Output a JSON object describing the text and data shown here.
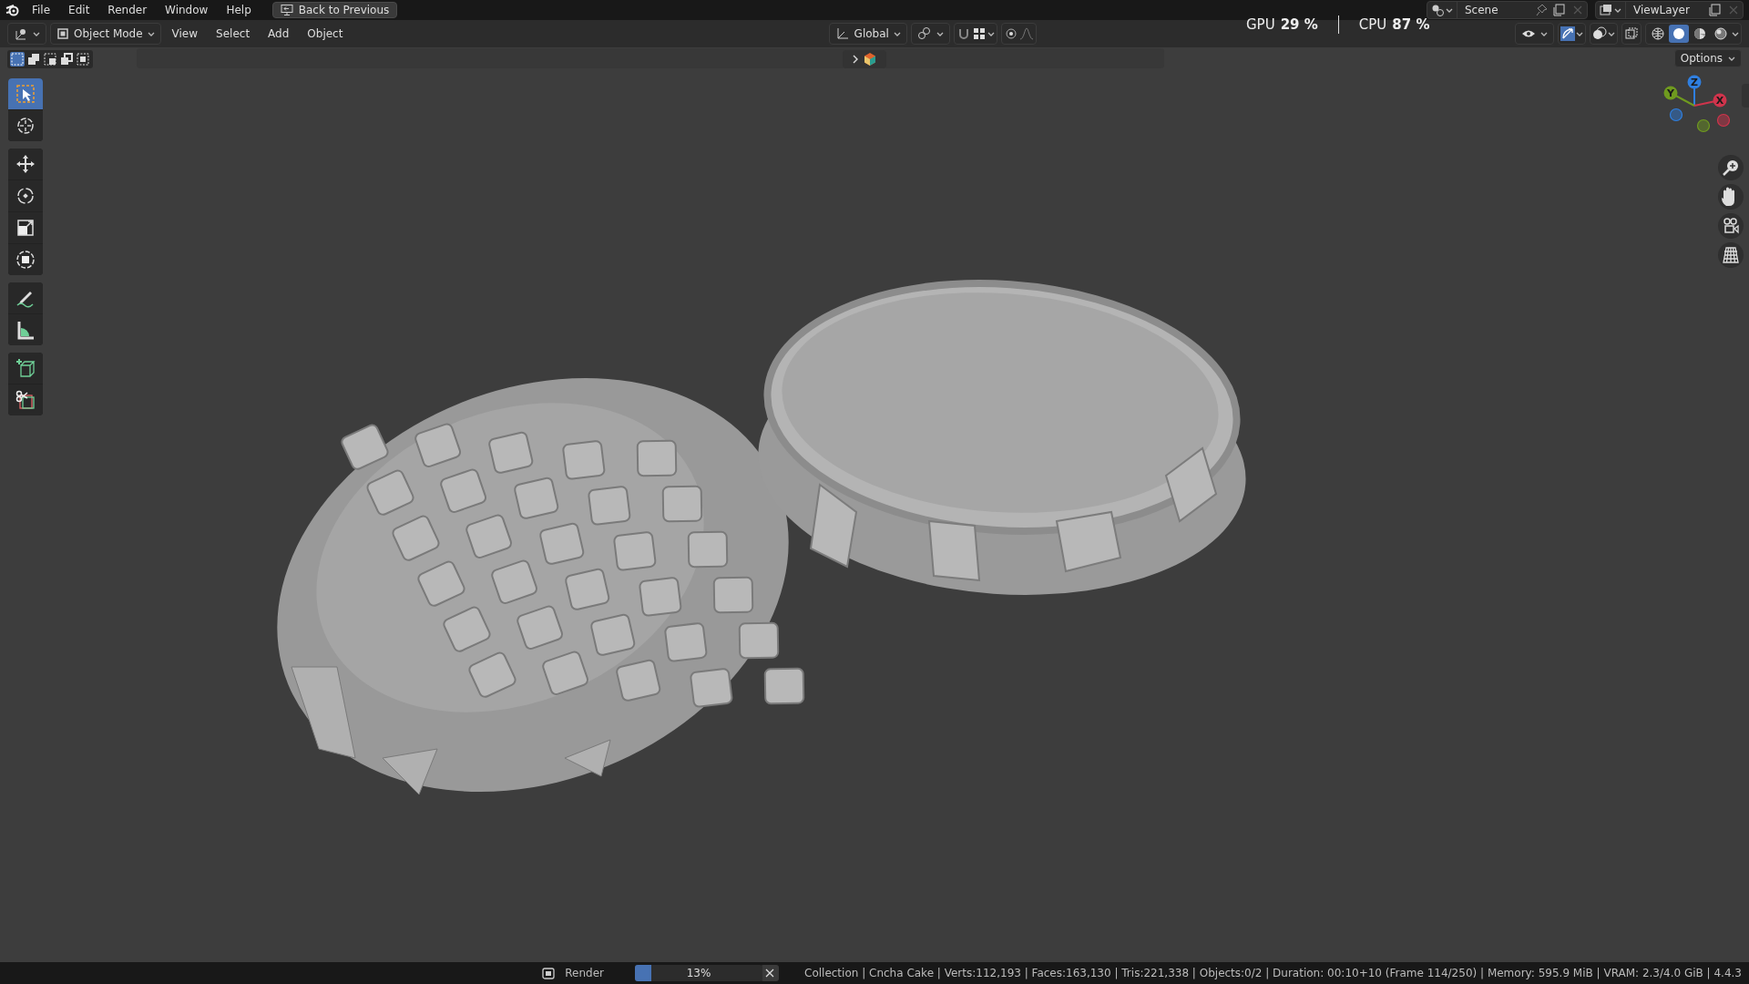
{
  "menu": [
    {
      "label": "File"
    },
    {
      "label": "Edit"
    },
    {
      "label": "Render"
    },
    {
      "label": "Window"
    },
    {
      "label": "Help"
    }
  ],
  "back_button": "Back to Previous",
  "scene": "Scene",
  "view_layer": "ViewLayer",
  "header": {
    "mode": "Object Mode",
    "menus": [
      "View",
      "Select",
      "Add",
      "Object"
    ],
    "orientation": "Global"
  },
  "performance": [
    {
      "label": "GPU",
      "value": "29 %"
    },
    {
      "label": "CPU",
      "value": "87 %"
    }
  ],
  "shading_modes": [
    {
      "kind": "wireframe",
      "selected": false
    },
    {
      "kind": "solid",
      "selected": true
    },
    {
      "kind": "material",
      "selected": false
    },
    {
      "kind": "rendered",
      "selected": false
    }
  ],
  "select_modes": [
    {
      "selected": true
    },
    {
      "selected": false
    },
    {
      "selected": false
    },
    {
      "selected": false
    },
    {
      "selected": false
    }
  ],
  "options": "Options",
  "tool_groups": [
    [
      {
        "kind": "select",
        "selected": true
      },
      {
        "kind": "cursor",
        "selected": false
      }
    ],
    [
      {
        "kind": "move",
        "selected": false
      },
      {
        "kind": "rotate",
        "selected": false
      },
      {
        "kind": "scale",
        "selected": false
      },
      {
        "kind": "transform",
        "selected": false
      }
    ],
    [
      {
        "kind": "annotate",
        "selected": false
      },
      {
        "kind": "measure",
        "selected": false
      }
    ],
    [
      {
        "kind": "add-cube",
        "selected": false
      },
      {
        "kind": "cut",
        "selected": false
      }
    ]
  ],
  "gizmo_axes": [
    {
      "label": "Z",
      "color": "#2f7fe0"
    },
    {
      "label": "Y",
      "color": "#6f9a1f"
    },
    {
      "label": "X",
      "color": "#d0344c"
    }
  ],
  "status": {
    "job": "Render",
    "progress": {
      "level": 0.13,
      "reading": "13%"
    },
    "info": "Collection | Cncha Cake | Verts:112,193 | Faces:163,130 | Tris:221,338 | Objects:0/2 | Duration: 00:10+10 (Frame 114/250) | Memory: 595.9 MiB | VRAM: 2.3/4.0 GiB | 4.4.3"
  }
}
